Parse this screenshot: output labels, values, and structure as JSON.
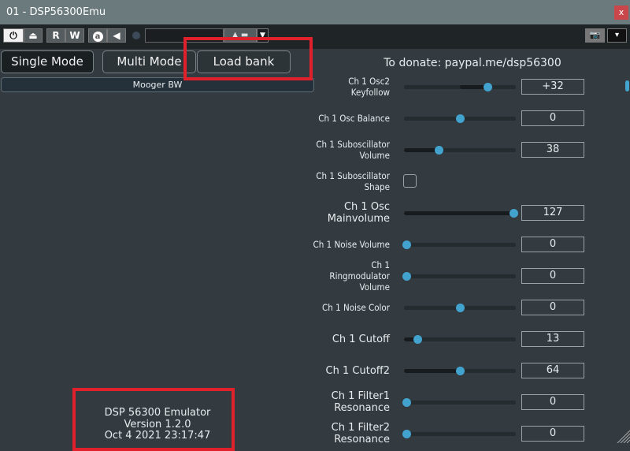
{
  "window": {
    "title": "01 - DSP56300Emu",
    "close_label": "x"
  },
  "toolbar": {
    "record_label": "R",
    "write_label": "W",
    "arrow_icon": "arrow-left-icon",
    "a_label": "a",
    "down_label": "▾"
  },
  "modes": {
    "single": "Single Mode",
    "multi": "Multi Mode",
    "load": "Load bank"
  },
  "preset": "Mooger  BW",
  "donate": "To donate: paypal.me/dsp56300",
  "about": {
    "line1": "DSP 56300 Emulator",
    "line2": "Version 1.2.0",
    "line3": "Oct  4 2021 23:17:47"
  },
  "accent": "#42a3cf",
  "params": [
    {
      "label": "Ch 1 Osc2 Keyfollow",
      "value": "+32",
      "pos": 0.76,
      "bipolar": true,
      "big": false
    },
    {
      "label": "Ch 1 Osc Balance",
      "value": "0",
      "pos": 0.5,
      "bipolar": true,
      "big": false
    },
    {
      "label": "Ch 1 Suboscillator Volume",
      "value": "38",
      "pos": 0.3,
      "big": false
    },
    {
      "label": "Ch 1 Suboscillator Shape",
      "checkbox": true,
      "big": false
    },
    {
      "label": "Ch 1 Osc Mainvolume",
      "value": "127",
      "pos": 1.0,
      "big": true
    },
    {
      "label": "Ch 1 Noise Volume",
      "value": "0",
      "pos": 0,
      "big": false
    },
    {
      "label": "Ch 1 Ringmodulator Volume",
      "value": "0",
      "pos": 0,
      "big": false
    },
    {
      "label": "Ch 1 Noise Color",
      "value": "0",
      "pos": 0.5,
      "bipolar": true,
      "big": false
    },
    {
      "label": "Ch 1 Cutoff",
      "value": "13",
      "pos": 0.1,
      "big": true
    },
    {
      "label": "Ch 1 Cutoff2",
      "value": "64",
      "pos": 0.5,
      "big": true
    },
    {
      "label": "Ch 1 Filter1 Resonance",
      "value": "0",
      "pos": 0,
      "big": true
    },
    {
      "label": "Ch 1 Filter2 Resonance",
      "value": "0",
      "pos": 0,
      "big": true
    }
  ]
}
